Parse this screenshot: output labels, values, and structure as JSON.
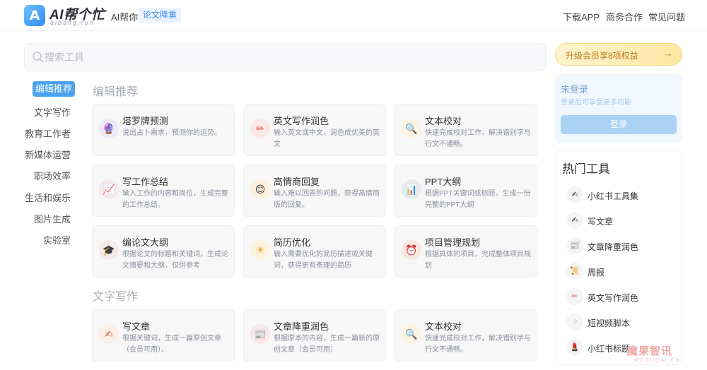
{
  "header": {
    "logo_mark": "A",
    "logo_name": "AI帮个忙",
    "logo_domain": "aibang.run",
    "ai_help": "AI帮你",
    "ai_tag": "论文降重",
    "nav": [
      "下载APP",
      "商务合作",
      "常见问题"
    ]
  },
  "search": {
    "placeholder": "搜索工具",
    "value": ""
  },
  "categories": [
    {
      "label": "编辑推荐",
      "active": true
    },
    {
      "label": "文字写作"
    },
    {
      "label": "教育工作者"
    },
    {
      "label": "新媒体运营"
    },
    {
      "label": "职场效率"
    },
    {
      "label": "生活和娱乐"
    },
    {
      "label": "图片生成"
    },
    {
      "label": "实验室"
    }
  ],
  "sections": [
    {
      "title": "编辑推荐",
      "cards": [
        {
          "title": "塔罗牌预测",
          "desc": "说出占卜需求，预测你的运势。",
          "icon": "crystal-ball-icon",
          "glyph": "🔮"
        },
        {
          "title": "英文写作润色",
          "desc": "输入英文或中文，润色成优美的英文",
          "icon": "pencil-icon",
          "glyph": "✏"
        },
        {
          "title": "文本校对",
          "desc": "快速完成校对工作，解决错别字与行文不通畅。",
          "icon": "magnifier-icon",
          "glyph": "🔍"
        },
        {
          "title": "写工作总结",
          "desc": "输入工作的内容和岗位，生成完整的工作总结。",
          "icon": "trend-chart-icon",
          "glyph": "📈"
        },
        {
          "title": "高情商回复",
          "desc": "输入难以回答的问题，获得高情商版的回复。",
          "icon": "smile-face-icon",
          "glyph": "😊"
        },
        {
          "title": "PPT大纲",
          "desc": "根据PPT关键词或标题，生成一份完整的PPT大纲",
          "icon": "bar-chart-icon",
          "glyph": "📊"
        },
        {
          "title": "编论文大纲",
          "desc": "根据论文的标题和关键词，生成论文摘要和大纲，仅供参考",
          "icon": "graduation-cap-icon",
          "glyph": "🎓"
        },
        {
          "title": "简历优化",
          "desc": "输入需要优化的简历描述或关键词，获得更有条理的简历",
          "icon": "sun-icon",
          "glyph": "☀"
        },
        {
          "title": "项目管理规划",
          "desc": "根据具体的项目，完成整体项目规划",
          "icon": "alarm-clock-icon",
          "glyph": "⏰"
        }
      ]
    },
    {
      "title": "文字写作",
      "cards": [
        {
          "title": "写文章",
          "desc": "根据关键词，生成一篇原创文章（会员可用）。",
          "icon": "quill-icon",
          "glyph": "✍"
        },
        {
          "title": "文章降重润色",
          "desc": "根据原本的内容，生成一篇新的原创文章（会员可用）",
          "icon": "article-icon",
          "glyph": "📰"
        },
        {
          "title": "文本校对",
          "desc": "快速完成校对工作，解决错别字与行文不通畅。",
          "icon": "magnifier-icon",
          "glyph": "🔍"
        }
      ]
    }
  ],
  "upgrade": {
    "label": "升级会员享8项权益",
    "arrow": "→"
  },
  "login": {
    "title": "未登录",
    "subtitle": "登录后可享受更多功能",
    "button": "登录"
  },
  "hot_tools": {
    "title": "热门工具",
    "items": [
      {
        "label": "小红书工具集",
        "icon": "quill-icon",
        "glyph": "✍"
      },
      {
        "label": "写文章",
        "icon": "quill-icon",
        "glyph": "✍"
      },
      {
        "label": "文章降重润色",
        "icon": "article-icon",
        "glyph": "📰"
      },
      {
        "label": "周报",
        "icon": "scroll-icon",
        "glyph": "📜"
      },
      {
        "label": "英文写作润色",
        "icon": "pencil-icon",
        "glyph": "✏"
      },
      {
        "label": "短视频脚本",
        "icon": "dots-icon",
        "glyph": "⁘"
      },
      {
        "label": "小红书标题",
        "icon": "lipstick-icon",
        "glyph": "💄"
      }
    ]
  },
  "watermark": {
    "cn": "魔果智讯",
    "en": "MOGUOAI.CN"
  },
  "colors": {
    "accent": "#4aa3f0",
    "upgrade_text": "#b37a13",
    "watermark": "#f0a7a7"
  }
}
